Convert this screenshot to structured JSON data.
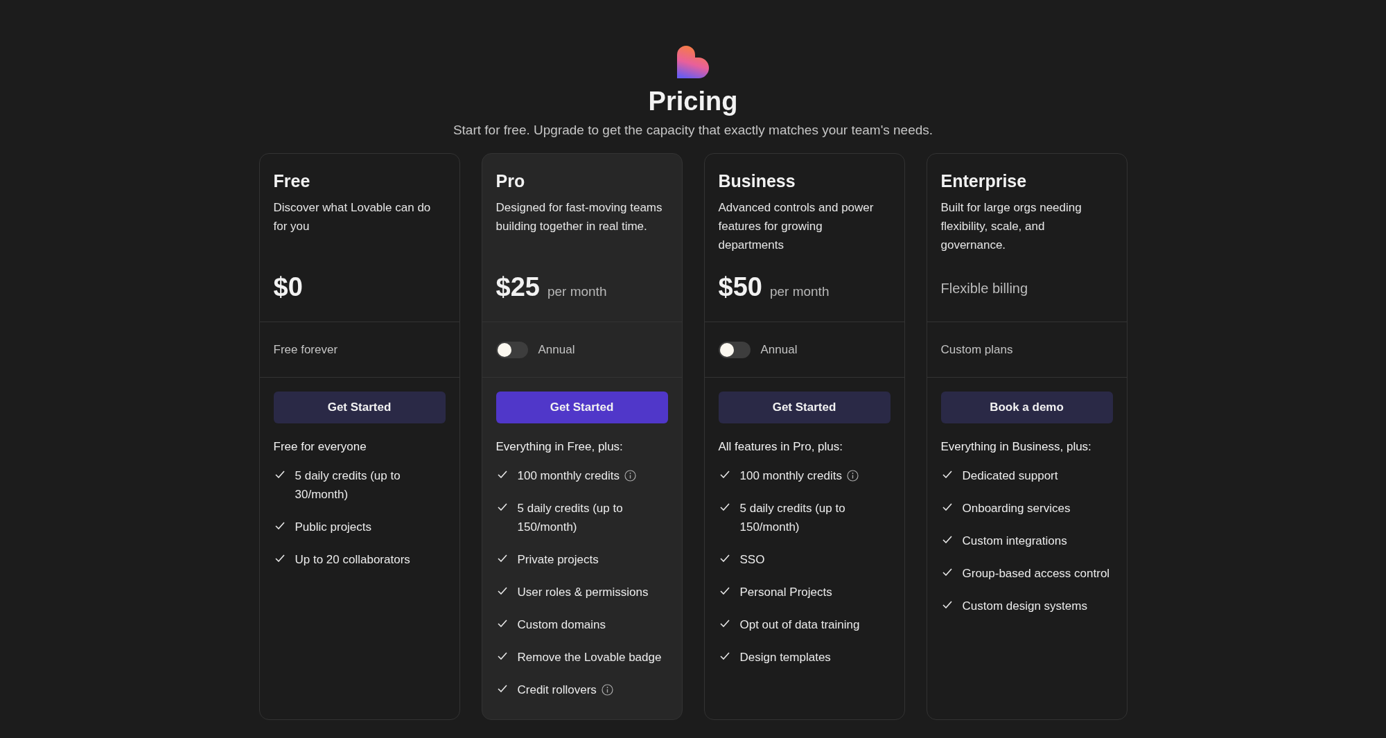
{
  "header": {
    "title": "Pricing",
    "subtitle": "Start for free. Upgrade to get the capacity that exactly matches your team's needs."
  },
  "plans": [
    {
      "name": "Free",
      "description": "Discover what Lovable can do for you",
      "price": "$0",
      "highlighted": false,
      "option": {
        "kind": "note",
        "text": "Free forever"
      },
      "button": "Get Started",
      "features_heading": "Free for everyone",
      "features": [
        {
          "text": "5 daily credits (up to 30/month)",
          "info": false
        },
        {
          "text": "Public projects",
          "info": false
        },
        {
          "text": "Up to 20 collaborators",
          "info": false
        }
      ]
    },
    {
      "name": "Pro",
      "description": "Designed for fast-moving teams building together in real time.",
      "price": "$25",
      "period": "per month",
      "highlighted": true,
      "option": {
        "kind": "toggle",
        "label": "Annual",
        "on": false
      },
      "button": "Get Started",
      "features_heading": "Everything in Free, plus:",
      "features": [
        {
          "text": "100 monthly credits",
          "info": true
        },
        {
          "text": "5 daily credits (up to 150/month)",
          "info": false
        },
        {
          "text": "Private projects",
          "info": false
        },
        {
          "text": "User roles & permissions",
          "info": false
        },
        {
          "text": "Custom domains",
          "info": false
        },
        {
          "text": "Remove the Lovable badge",
          "info": false
        },
        {
          "text": "Credit rollovers",
          "info": true
        }
      ]
    },
    {
      "name": "Business",
      "description": "Advanced controls and power features for growing departments",
      "price": "$50",
      "period": "per month",
      "highlighted": false,
      "option": {
        "kind": "toggle",
        "label": "Annual",
        "on": false
      },
      "button": "Get Started",
      "features_heading": "All features in Pro, plus:",
      "features": [
        {
          "text": "100 monthly credits",
          "info": true
        },
        {
          "text": "5 daily credits (up to 150/month)",
          "info": false
        },
        {
          "text": "SSO",
          "info": false
        },
        {
          "text": "Personal Projects",
          "info": false
        },
        {
          "text": "Opt out of data training",
          "info": false
        },
        {
          "text": "Design templates",
          "info": false
        }
      ]
    },
    {
      "name": "Enterprise",
      "description": "Built for large orgs needing flexibility, scale, and governance.",
      "billing_note": "Flexible billing",
      "highlighted": false,
      "option": {
        "kind": "note",
        "text": "Custom plans"
      },
      "button": "Book a demo",
      "features_heading": "Everything in Business, plus:",
      "features": [
        {
          "text": "Dedicated support",
          "info": false
        },
        {
          "text": "Onboarding services",
          "info": false
        },
        {
          "text": "Custom integrations",
          "info": false
        },
        {
          "text": "Group-based access control",
          "info": false
        },
        {
          "text": "Custom design systems",
          "info": false
        }
      ]
    }
  ]
}
